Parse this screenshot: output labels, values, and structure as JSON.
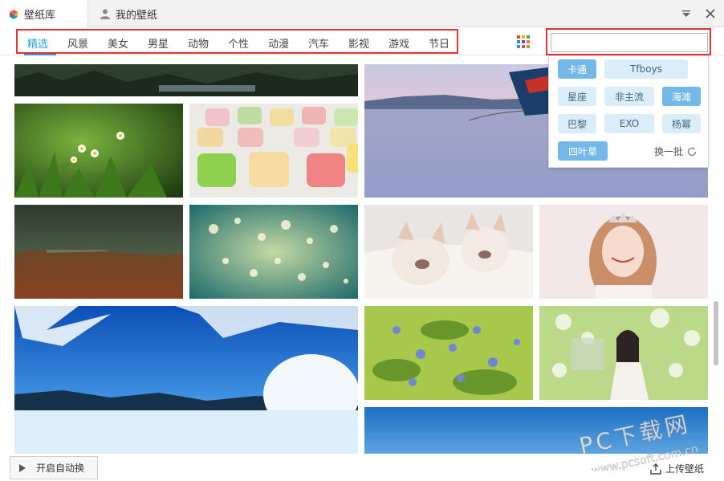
{
  "tabs": {
    "library": "壁纸库",
    "mine": "我的壁纸"
  },
  "categories": [
    "精选",
    "风景",
    "美女",
    "男星",
    "动物",
    "个性",
    "动漫",
    "汽车",
    "影视",
    "游戏",
    "节日"
  ],
  "search": {
    "value": "",
    "placeholder": ""
  },
  "suggestions": {
    "tags": [
      "卡通",
      "Tfboys",
      "星座",
      "非主流",
      "海滩",
      "巴黎",
      "EXO",
      "杨幂",
      "四叶草"
    ],
    "refresh": "换一批"
  },
  "bottom": {
    "autoplay": "开启自动换",
    "upload": "上传壁纸"
  },
  "watermark": {
    "line1": "PC下载网",
    "line2": "www.pcsoft.com.cn"
  },
  "colors": {
    "accent": "#1d9fe6",
    "highlight_outline": "#e8302f",
    "tag_dark": "#74b8ea",
    "tag_light": "#dcedfa"
  }
}
